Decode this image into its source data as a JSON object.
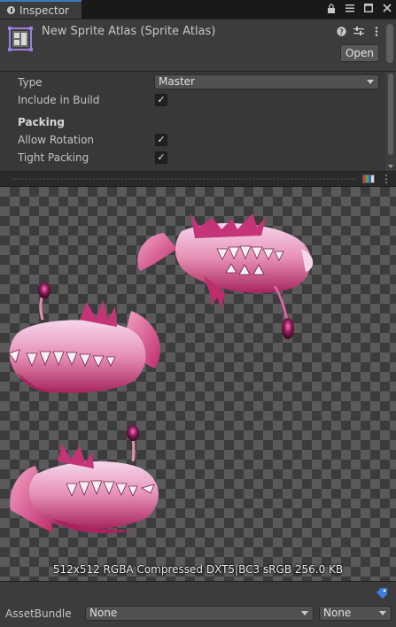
{
  "tab": {
    "label": "Inspector",
    "icon": "info-icon"
  },
  "window_tools": [
    "lock-icon",
    "menu-icon",
    "maximize-icon",
    "close-icon"
  ],
  "header": {
    "title": "New Sprite Atlas (Sprite Atlas)",
    "tools": [
      "help-icon",
      "preset-icon",
      "kebab-menu-icon"
    ],
    "open_label": "Open"
  },
  "properties": {
    "type_label": "Type",
    "type_value": "Master",
    "include_label": "Include in Build",
    "include_checked": true,
    "packing_heading": "Packing",
    "allow_rotation_label": "Allow Rotation",
    "allow_rotation_checked": true,
    "tight_packing_label": "Tight Packing",
    "tight_packing_checked": true
  },
  "preview": {
    "texture_info": "512x512 RGBA Compressed DXT5|BC3 sRGB   256.0 KB"
  },
  "asset_bundle": {
    "label": "AssetBundle",
    "name_value": "None",
    "variant_value": "None"
  },
  "colors": {
    "accent": "#3a79bb",
    "creature_pink": "#e58fb4",
    "creature_magenta": "#b8286a",
    "tag_blue": "#3d7de0"
  }
}
